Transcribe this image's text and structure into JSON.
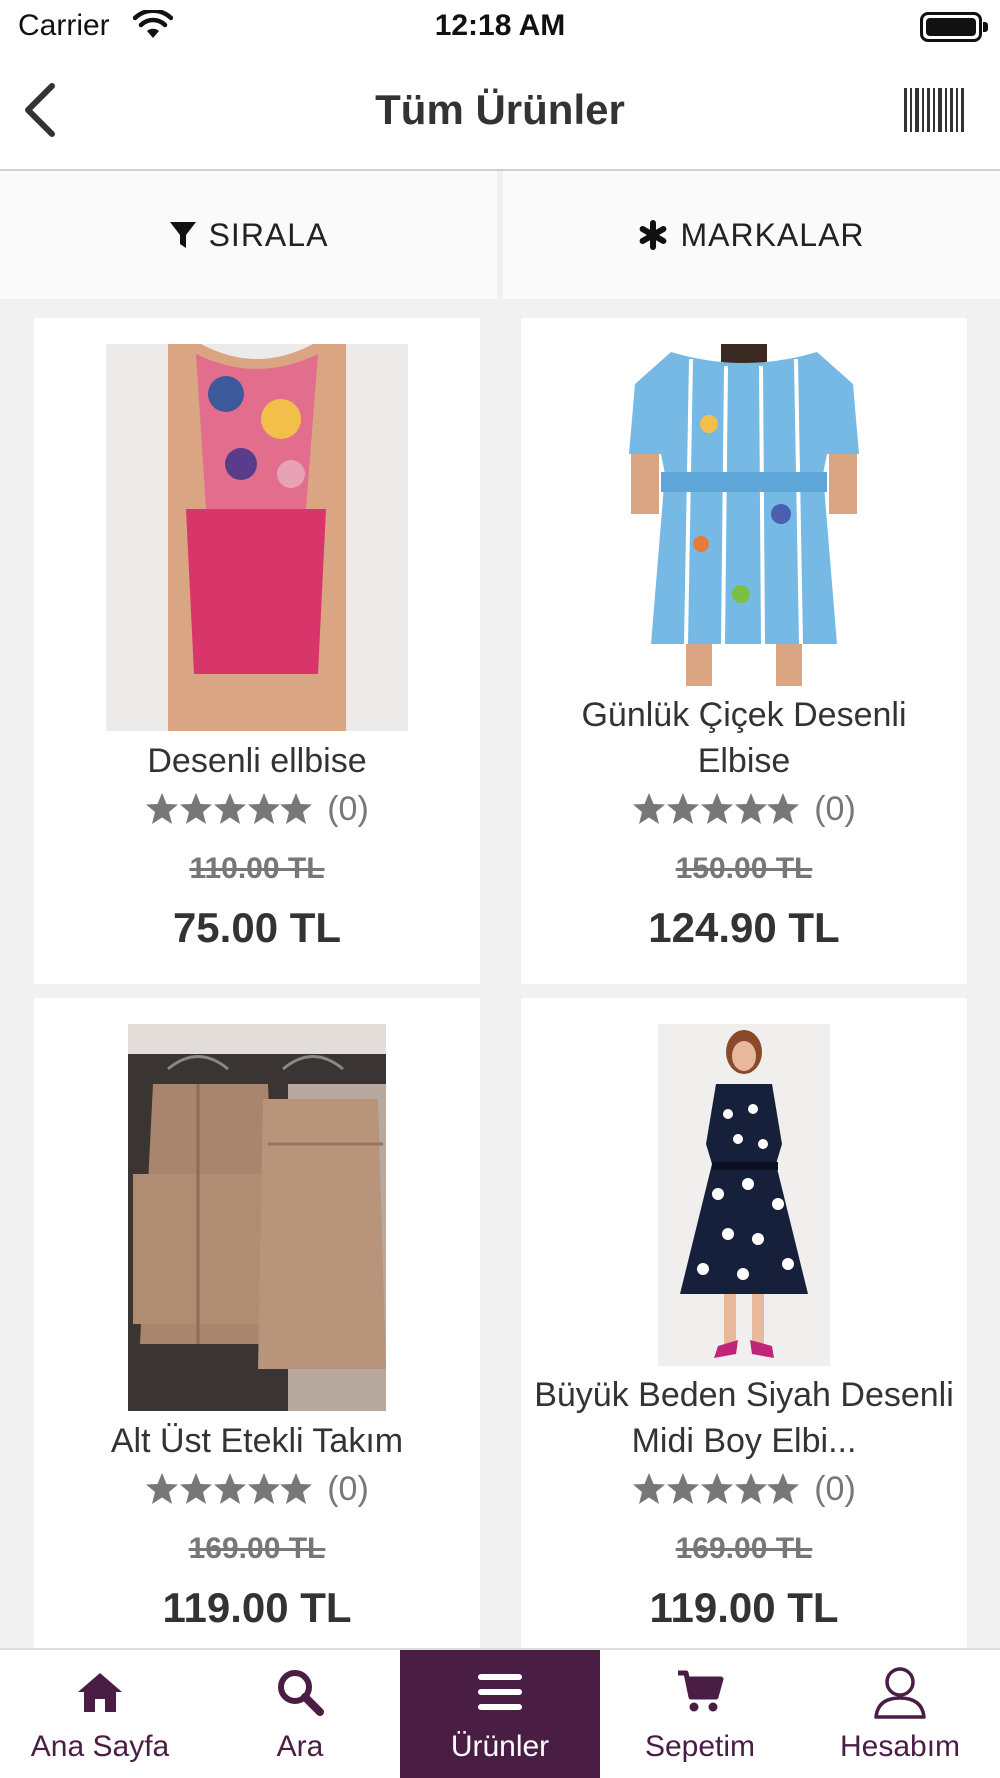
{
  "status_bar": {
    "carrier": "Carrier",
    "time": "12:18 AM"
  },
  "nav": {
    "title": "Tüm Ürünler"
  },
  "filters": {
    "sort_label": "SIRALA",
    "brands_label": "MARKALAR"
  },
  "products": [
    {
      "name": "Desenli ellbise",
      "rating_count": "(0)",
      "old_price": "110.00 TL",
      "price": "75.00 TL"
    },
    {
      "name": "Günlük Çiçek Desenli Elbise",
      "rating_count": "(0)",
      "old_price": "150.00 TL",
      "price": "124.90 TL"
    },
    {
      "name": "Alt Üst Etekli Takım",
      "rating_count": "(0)",
      "old_price": "169.00 TL",
      "price": "119.00 TL"
    },
    {
      "name": "Büyük Beden Siyah Desenli Midi Boy Elbi...",
      "rating_count": "(0)",
      "old_price": "169.00 TL",
      "price": "119.00 TL"
    }
  ],
  "tabs": [
    {
      "label": "Ana Sayfa",
      "icon": "home-icon"
    },
    {
      "label": "Ara",
      "icon": "search-icon"
    },
    {
      "label": "Ürünler",
      "icon": "menu-icon",
      "active": true
    },
    {
      "label": "Sepetim",
      "icon": "cart-icon"
    },
    {
      "label": "Hesabım",
      "icon": "user-icon"
    }
  ],
  "colors": {
    "brand": "#4a1d45",
    "star": "#777777",
    "background": "#f1f1f1"
  }
}
